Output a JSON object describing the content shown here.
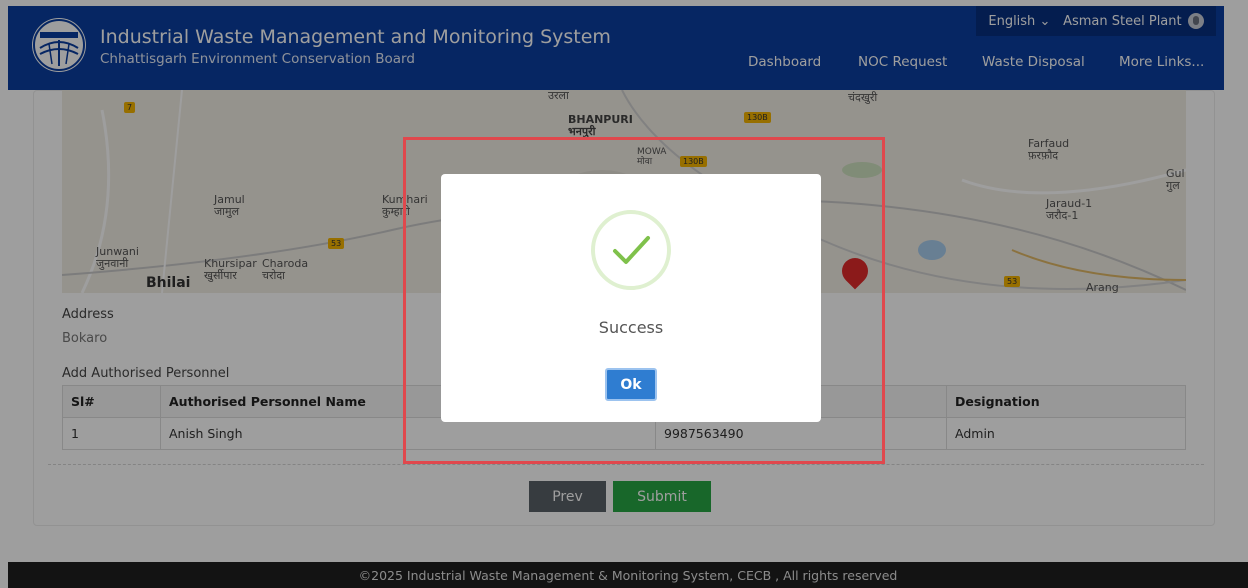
{
  "header": {
    "title": "Industrial Waste Management and Monitoring System",
    "subtitle": "Chhattisgarh Environment Conservation Board",
    "language": "English",
    "plant": "Asman Steel Plant",
    "nav": [
      "Dashboard",
      "NOC Request",
      "Waste Disposal",
      "More Links..."
    ]
  },
  "map": {
    "labels": [
      "Jamul\nजामुल",
      "Junwani\nजुनवानी",
      "Khursipar\nखुर्सीपार",
      "Charoda\nचरोदा",
      "Bhilai",
      "BHANPURI\nभनपुरी",
      "MOWA\nमोवा",
      "Kumhari\nकुम्हारी",
      "Farfaud\nफ़रफ़ौद",
      "Jaraud-1\nजरौद-1",
      "Gul\nगुल",
      "Arang",
      "उरला",
      "चंदखुरी"
    ],
    "road_badges": [
      "7",
      "53",
      "130B",
      "130B",
      "53"
    ]
  },
  "form": {
    "address_label": "Address",
    "address_value": "Bokaro",
    "personnel_heading": "Add Authorised Personnel",
    "columns": [
      "Sl#",
      "Authorised Personnel Name",
      "",
      "Designation"
    ],
    "rows": [
      [
        "1",
        "Anish Singh",
        "9987563490",
        "Admin"
      ]
    ],
    "prev_label": "Prev",
    "submit_label": "Submit"
  },
  "footer": {
    "text": "©2025 Industrial Waste Management & Monitoring System, CECB , All rights reserved"
  },
  "modal": {
    "message": "Success",
    "ok_label": "Ok"
  },
  "colors": {
    "header_bg": "#0b3ea0",
    "submit_bg": "#28a745",
    "prev_bg": "#5a6268",
    "ok_bg": "#2f7dd1",
    "highlight": "#e0484d",
    "success_check": "#7fc14b"
  }
}
